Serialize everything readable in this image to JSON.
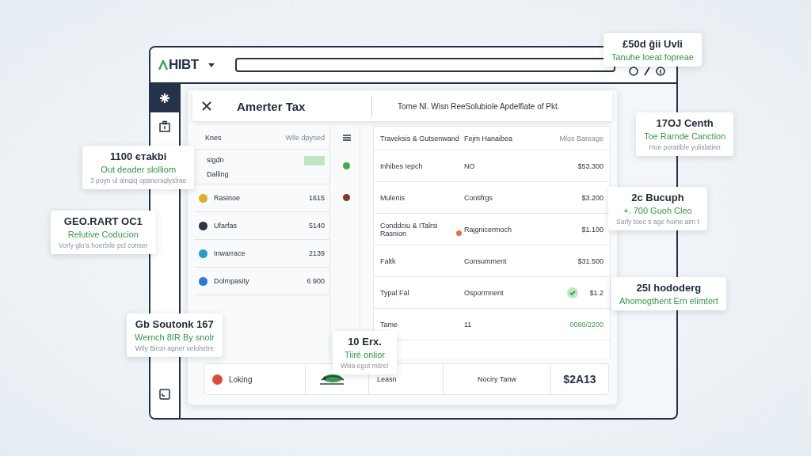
{
  "app": {
    "logo": "HIBT"
  },
  "sidebar": {
    "items": [
      {
        "selected": true
      },
      {
        "selected": false
      },
      {
        "selected": false
      }
    ]
  },
  "header": {
    "title": "Amerter Tax",
    "subtitle": "Tome Nl. Wisn ReeSolubiole Apdelfiate of Pkt."
  },
  "left_table": {
    "columns": [
      "Knes",
      "Wile dpyned"
    ],
    "rows": [
      {
        "kind": "bar",
        "name": "sigdn",
        "sub": "Dalling",
        "level": 1
      },
      {
        "kind": "icon",
        "name": "Rasinoe",
        "value": "1615",
        "color": "#e3ad22"
      },
      {
        "kind": "icon",
        "name": "Ufarfas",
        "value": "5140",
        "color": "#2f3640"
      },
      {
        "kind": "icon",
        "name": "Inwarrace",
        "value": "2139",
        "color": "#2b9bcb"
      },
      {
        "kind": "icon",
        "name": "Dolmpasity",
        "value": "6 900",
        "color": "#2a78db"
      }
    ]
  },
  "status_column": [
    {
      "color": "#3cae48"
    },
    {
      "color": "#8b3a1f"
    }
  ],
  "right_table": {
    "columns": [
      "Traveksis & Gutsenwand",
      "Fejm Hanaibea",
      "Mlos Bareage"
    ],
    "rows": [
      {
        "cells": [
          "Inhibes Iepch",
          "NO",
          "$53.300"
        ],
        "flag": false,
        "check": false,
        "highlight": false
      },
      {
        "cells": [
          "Mulenis",
          "Contifrgs",
          "$3.200"
        ],
        "flag": false,
        "check": false,
        "highlight": false
      },
      {
        "cells": [
          "Conddciu & ITalrsi Rasnion",
          "Rajgnicermoch",
          "$1.100"
        ],
        "flag": true,
        "check": false,
        "highlight": false
      },
      {
        "cells": [
          "Faltk",
          "Consumment",
          "$31.500"
        ],
        "flag": false,
        "check": false,
        "highlight": false
      },
      {
        "cells": [
          "Typal Fal",
          "Ospormnent",
          "$1.2"
        ],
        "flag": false,
        "check": true,
        "highlight": false
      },
      {
        "cells": [
          "Tame",
          "11",
          "0080/2200"
        ],
        "flag": false,
        "check": false,
        "highlight": true
      }
    ]
  },
  "footer_row": {
    "name": "Loking",
    "cells": [
      "Leasn",
      "Nociry Tanw"
    ],
    "total": "$2A13"
  },
  "callouts": [
    {
      "title": "£50d ĝii Uvli",
      "subtitle": "Tanuhe Ioeat fopreae"
    },
    {
      "title": "17OJ Centh",
      "subtitle": "Toe Rarnde Canction",
      "note": "Hoe poratible yolislatinn"
    },
    {
      "title": "1100 єтаkbi",
      "subtitle": "Out deader slolliom",
      "note": "3 poyn ul alnqiq opaneniqlyslrae"
    },
    {
      "title": "GEO.RART OC1",
      "subtitle": "Relutive Coducion",
      "note": "Vorly glo'a hoerbile pcl conser"
    },
    {
      "title": "2c Bucuph",
      "subtitle": "+. 700 Guoh Cleo",
      "note": "Sarly toec s age hoine aim t"
    },
    {
      "title": "25I hododerg",
      "subtitle": "Ahomogthent Ern elimtert"
    },
    {
      "title": "Gb Soutonk 167",
      "subtitle": "Wernch 8IR By snolr",
      "note": "Wily Biron agner velolsrtre"
    },
    {
      "title": "10 Erx.",
      "subtitle": "Tiiré onlior",
      "note": "Wiiia egot mitre!"
    }
  ]
}
